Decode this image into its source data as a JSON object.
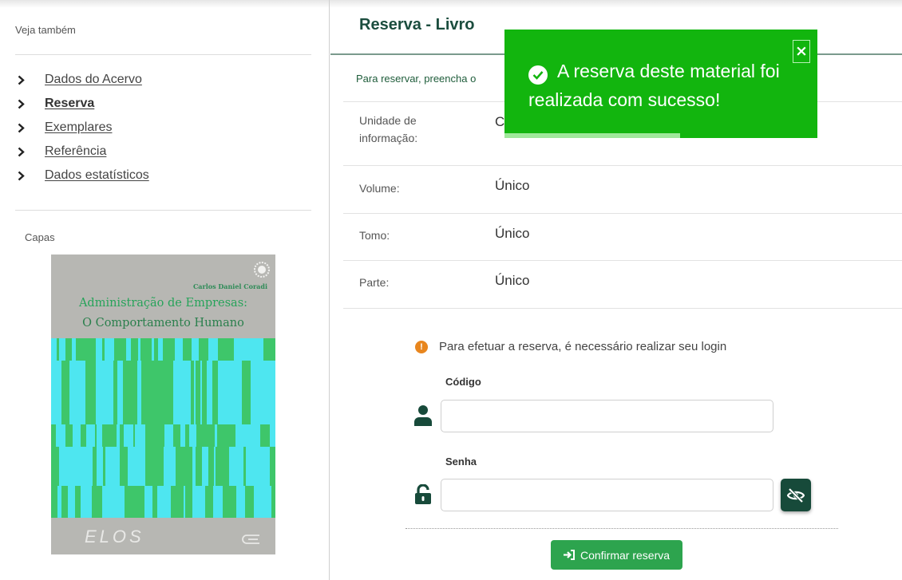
{
  "sidebar": {
    "see_also_title": "Veja também",
    "nav": [
      {
        "label": "Dados do Acervo",
        "active": false
      },
      {
        "label": "Reserva",
        "active": true
      },
      {
        "label": "Exemplares",
        "active": false
      },
      {
        "label": "Referência",
        "active": false
      },
      {
        "label": "Dados estatísticos",
        "active": false
      }
    ],
    "covers_title": "Capas",
    "cover": {
      "author": "Carlos Daniel Coradi",
      "title_line1": "Administração de Empresas:",
      "title_line2": "O Comportamento Humano",
      "publisher": "ELOS"
    }
  },
  "main": {
    "title": "Reserva - Livro",
    "instruction": "Para reservar, preencha o",
    "fields": [
      {
        "label_line1": "Unidade de",
        "label_line2": "informação:",
        "value": "C"
      },
      {
        "label_line1": "Volume:",
        "label_line2": "",
        "value": "Único"
      },
      {
        "label_line1": "Tomo:",
        "label_line2": "",
        "value": "Único"
      },
      {
        "label_line1": "Parte:",
        "label_line2": "",
        "value": "Único"
      }
    ],
    "login": {
      "message": "Para efetuar a reserva, é necessário realizar seu login",
      "code_label": "Código",
      "code_value": "",
      "password_label": "Senha",
      "password_value": "",
      "confirm_label": "Confirmar reserva"
    }
  },
  "toast": {
    "message": "A reserva deste material foi realizada com sucesso!",
    "close_label": "×",
    "progress": 0.56
  },
  "colors": {
    "brand_dark": "#174a3a",
    "toast_green": "#12b50e",
    "button_green": "#2da44e",
    "warning_orange": "#e8861e"
  }
}
